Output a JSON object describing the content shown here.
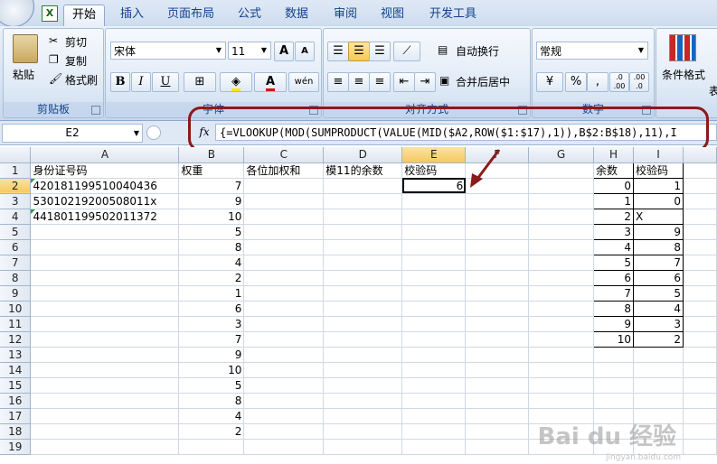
{
  "tabs": [
    "开始",
    "插入",
    "页面布局",
    "公式",
    "数据",
    "审阅",
    "视图",
    "开发工具"
  ],
  "clipboard": {
    "paste": "粘贴",
    "cut": "剪切",
    "copy": "复制",
    "painter": "格式刷",
    "label": "剪贴板"
  },
  "font": {
    "name": "宋体",
    "size": "11",
    "grow": "A",
    "shrink": "A",
    "bold": "B",
    "italic": "I",
    "underline": "U",
    "label": "字体",
    "phonetic": "wén"
  },
  "alignment": {
    "wrap": "自动换行",
    "merge": "合并后居中",
    "label": "对齐方式"
  },
  "number": {
    "format": "常规",
    "percent": "%",
    "comma": ",",
    "inc": ".0 .00",
    "dec": ".00 .0",
    "label": "数字"
  },
  "styles": {
    "conditional": "条件格式",
    "table": "表"
  },
  "formula_bar": {
    "name_box": "E2",
    "fx": "fx",
    "formula": "{=VLOOKUP(MOD(SUMPRODUCT(VALUE(MID($A2,ROW($1:$17),1)),B$2:B$18),11),I"
  },
  "columns": [
    "A",
    "B",
    "C",
    "D",
    "E",
    "F",
    "G",
    "H",
    "I"
  ],
  "rows": [
    [
      "身份证号码",
      "权重",
      "各位加权和",
      "模11的余数",
      "校验码",
      "",
      "",
      "余数",
      "校验码"
    ],
    [
      "420181199510040436",
      "7",
      "",
      "",
      "6",
      "",
      "",
      "0",
      "1"
    ],
    [
      "53010219200508011x",
      "9",
      "",
      "",
      "",
      "",
      "",
      "1",
      "0"
    ],
    [
      "441801199502011372",
      "10",
      "",
      "",
      "",
      "",
      "",
      "2",
      "X"
    ],
    [
      "",
      "5",
      "",
      "",
      "",
      "",
      "",
      "3",
      "9"
    ],
    [
      "",
      "8",
      "",
      "",
      "",
      "",
      "",
      "4",
      "8"
    ],
    [
      "",
      "4",
      "",
      "",
      "",
      "",
      "",
      "5",
      "7"
    ],
    [
      "",
      "2",
      "",
      "",
      "",
      "",
      "",
      "6",
      "6"
    ],
    [
      "",
      "1",
      "",
      "",
      "",
      "",
      "",
      "7",
      "5"
    ],
    [
      "",
      "6",
      "",
      "",
      "",
      "",
      "",
      "8",
      "4"
    ],
    [
      "",
      "3",
      "",
      "",
      "",
      "",
      "",
      "9",
      "3"
    ],
    [
      "",
      "7",
      "",
      "",
      "",
      "",
      "",
      "10",
      "2"
    ],
    [
      "",
      "9",
      "",
      "",
      "",
      "",
      "",
      "",
      ""
    ],
    [
      "",
      "10",
      "",
      "",
      "",
      "",
      "",
      "",
      ""
    ],
    [
      "",
      "5",
      "",
      "",
      "",
      "",
      "",
      "",
      ""
    ],
    [
      "",
      "8",
      "",
      "",
      "",
      "",
      "",
      "",
      ""
    ],
    [
      "",
      "4",
      "",
      "",
      "",
      "",
      "",
      "",
      ""
    ],
    [
      "",
      "2",
      "",
      "",
      "",
      "",
      "",
      "",
      ""
    ],
    [
      "",
      "",
      "",
      "",
      "",
      "",
      "",
      "",
      ""
    ]
  ],
  "watermark": {
    "logo": "Bai du 经验",
    "url": "jingyan.baidu.com"
  },
  "colors": {
    "highlight": "#8b1a1a",
    "ribbon": "#dfe9f5",
    "selected_header": "#f5c95c"
  }
}
